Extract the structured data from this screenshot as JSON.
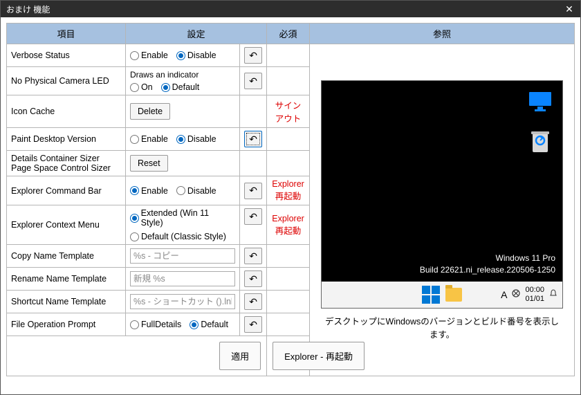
{
  "window": {
    "title": "おまけ 機能"
  },
  "headers": {
    "item": "項目",
    "setting": "設定",
    "required": "必須",
    "reference": "参照"
  },
  "requiredText": {
    "signout": "サインアウト",
    "explorerRestart1": "Explorer",
    "explorerRestart2": "再起動"
  },
  "rows": {
    "verboseStatus": {
      "label": "Verbose Status",
      "opt1": "Enable",
      "opt2": "Disable"
    },
    "noCamLed": {
      "label": "No Physical Camera LED",
      "note": "Draws an indicator",
      "opt1": "On",
      "opt2": "Default"
    },
    "iconCache": {
      "label": "Icon Cache",
      "btn": "Delete"
    },
    "paintDesktop": {
      "label": "Paint Desktop Version",
      "opt1": "Enable",
      "opt2": "Disable"
    },
    "detailsSizer": {
      "label1": "Details Container Sizer",
      "label2": "Page Space Control Sizer",
      "btn": "Reset"
    },
    "explorerCmdBar": {
      "label": "Explorer Command Bar",
      "opt1": "Enable",
      "opt2": "Disable"
    },
    "explorerCtxMenu": {
      "label": "Explorer Context Menu",
      "opt1": "Extended (Win 11 Style)",
      "opt2": "Default (Classic Style)"
    },
    "copyNameTpl": {
      "label": "Copy Name Template",
      "placeholder": "%s - コピー"
    },
    "renameTpl": {
      "label": "Rename Name Template",
      "placeholder": "新規 %s"
    },
    "shortcutTpl": {
      "label": "Shortcut Name Template",
      "placeholder": "%s - ショートカット ().lnk"
    },
    "fileOpPrompt": {
      "label": "File Operation Prompt",
      "opt1": "FullDetails",
      "opt2": "Default"
    }
  },
  "preview": {
    "osLine1": "Windows 11 Pro",
    "osLine2": "Build 22621.ni_release.220506-1250",
    "time": "00:00",
    "date": "01/01",
    "imeA": "A",
    "caption": "デスクトップにWindowsのバージョンとビルド番号を表示します。"
  },
  "footer": {
    "apply": "適用",
    "explorerRestart": "Explorer - 再起動"
  }
}
